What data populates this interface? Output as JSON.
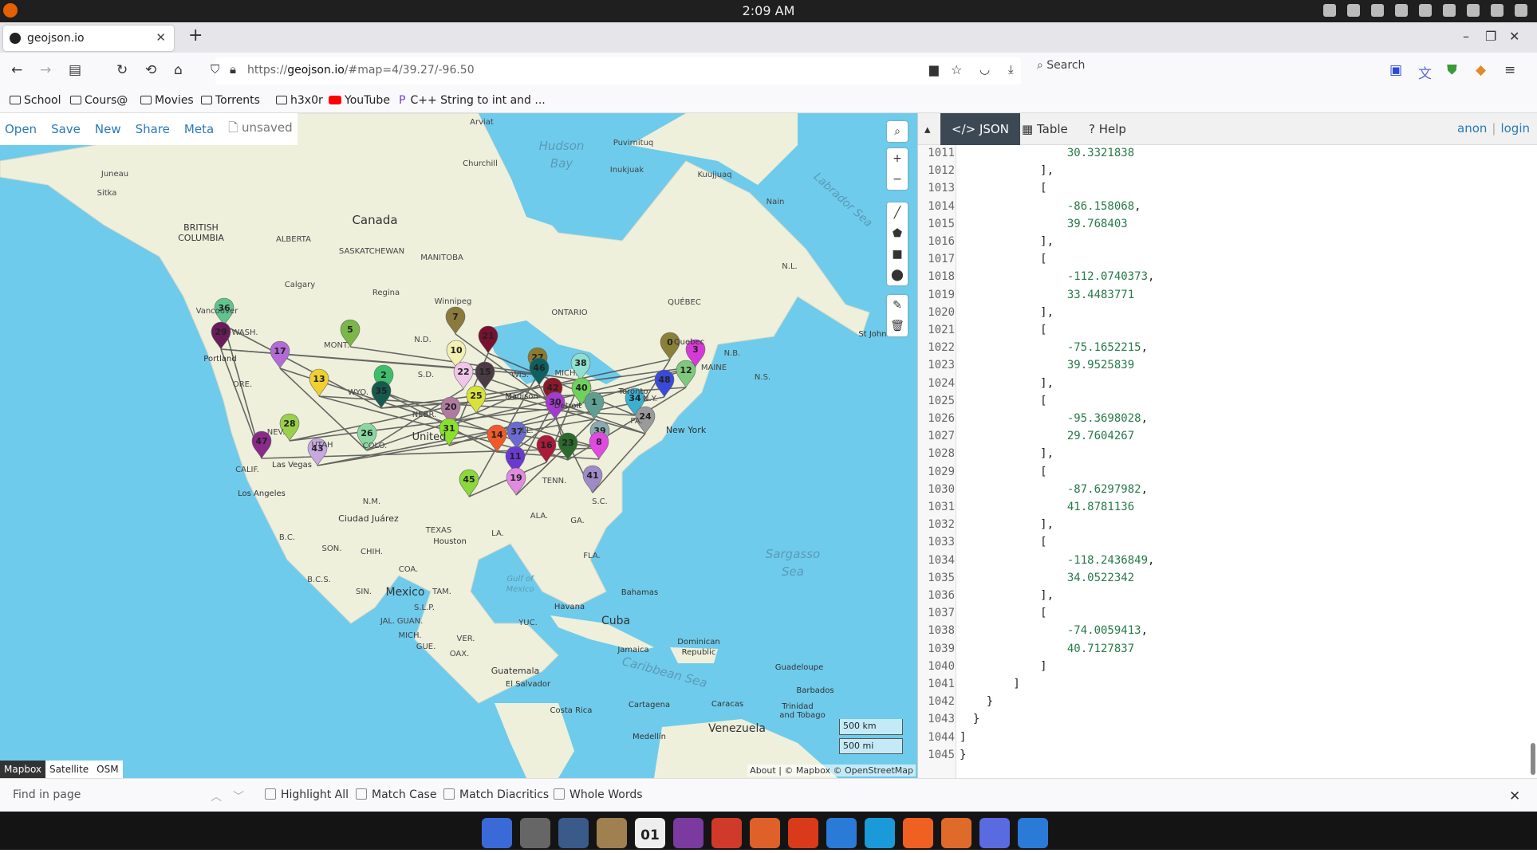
{
  "system": {
    "clock": "2:09 AM"
  },
  "tab": {
    "title": "geojson.io"
  },
  "address": {
    "prefix": "https://",
    "host": "geojson.io",
    "path": "/#map=4/39.27/-96.50",
    "search_placeholder": "Search"
  },
  "bookmarks": [
    "School",
    "Cours@",
    "Movies",
    "Torrents",
    "h3x0r",
    "YouTube",
    "C++ String to int and ..."
  ],
  "toolbar": {
    "open": "Open",
    "save": "Save",
    "new": "New",
    "share": "Share",
    "meta": "Meta",
    "status": "unsaved"
  },
  "panel_tabs": {
    "json": "JSON",
    "table": "Table",
    "help": "Help"
  },
  "auth": {
    "anon": "anon",
    "sep": "|",
    "login": "login"
  },
  "map_labels": {
    "hudson": "Hudson",
    "bay": "Bay",
    "canada": "Canada",
    "bc1": "BRITISH",
    "bc2": "COLUMBIA",
    "alberta": "ALBERTA",
    "sask": "SASKATCHEWAN",
    "manitoba": "MANITOBA",
    "ontario": "ONTARIO",
    "quebec_prov": "QUÉBEC",
    "nl": "N.L.",
    "nb": "N.B.",
    "ns": "N.S.",
    "labrador": "Labrador Sea",
    "arviat": "Arviat",
    "churchill": "Churchill",
    "puvirnituq": "Puvirnituq",
    "inukjuak": "Inukjuak",
    "kuujjuaq": "Kuujjuaq",
    "nain": "Nain",
    "juneau": "Juneau",
    "sitka": "Sitka",
    "calgary": "Calgary",
    "regina": "Regina",
    "winnipeg": "Winnipeg",
    "vancouver": "Vancouver",
    "wash": "WASH.",
    "mont": "MONT.",
    "nd": "N.D.",
    "sd": "S.D.",
    "wyo": "WYO.",
    "ore": "ORE.",
    "nev": "NEV.",
    "utah": "UTAH",
    "colo": "COLO.",
    "calif": "CALIF.",
    "nebr": "NEBR.",
    "ill": "ILL.",
    "mich": "MICH.",
    "wis": "WIS.",
    "ny": "N.Y.",
    "maine": "MAINE",
    "pa": "PA.",
    "tenn": "TENN.",
    "ga": "GA.",
    "sc": "S.C.",
    "fla": "FLA.",
    "texas": "TEXAS",
    "nm": "N.M.",
    "la": "LA.",
    "ala": "ALA.",
    "portland": "Portland",
    "lasvegas": "Las Vegas",
    "losangeles": "Los Angeles",
    "houston": "Houston",
    "newyork": "New York",
    "toronto": "Toronto",
    "quebec": "Quebec",
    "stjohn": "St John",
    "detroit": "Detroit",
    "madison": "Madison",
    "ciudad": "Ciudad Juárez",
    "son": "SON.",
    "chih": "CHIH.",
    "coa": "COA.",
    "bc": "B.C.",
    "bcs": "B.C.S.",
    "sin": "SIN.",
    "mexico": "Mexico",
    "tam": "TAM.",
    "slp": "S.L.P.",
    "jal": "JAL.",
    "guan": "GUAN.",
    "mich_mx": "MICH.",
    "gue": "GUE.",
    "oax": "OAX.",
    "ver": "VER.",
    "yuc": "YUC.",
    "gulf1": "Gulf of",
    "gulf2": "Mexico",
    "sargasso1": "Sargasso",
    "sargasso2": "Sea",
    "bahamas": "Bahamas",
    "havana": "Havana",
    "cuba": "Cuba",
    "jamaica": "Jamaica",
    "dominican1": "Dominican",
    "dominican2": "Republic",
    "guadeloupe": "Guadeloupe",
    "barbados": "Barbados",
    "caribbean": "Caribbean Sea",
    "guatemala": "Guatemala",
    "elsalvador": "El Salvador",
    "costarica": "Costa Rica",
    "cartagena": "Cartagena",
    "caracas": "Caracas",
    "trinidad1": "Trinidad",
    "trinidad2": "and Tobago",
    "venezuela": "Venezuela",
    "medellin": "Medellín",
    "united": "United"
  },
  "scale": {
    "km": "500 km",
    "mi": "500 mi"
  },
  "attribution": "About | © Mapbox © OpenStreetMap",
  "layers": [
    "Mapbox",
    "Satellite",
    "OSM"
  ],
  "markers": [
    {
      "n": "36",
      "c": "#5fc58f"
    },
    {
      "n": "29",
      "c": "#6a1b5a"
    },
    {
      "n": "17",
      "c": "#b36ad6"
    },
    {
      "n": "5",
      "c": "#7ab648"
    },
    {
      "n": "7",
      "c": "#8a7a3c"
    },
    {
      "n": "21",
      "c": "#7a1030"
    },
    {
      "n": "10",
      "c": "#f3f0b0"
    },
    {
      "n": "13",
      "c": "#f0d030"
    },
    {
      "n": "2",
      "c": "#3dbf6a"
    },
    {
      "n": "35",
      "c": "#155a4d"
    },
    {
      "n": "22",
      "c": "#f2c6ea"
    },
    {
      "n": "15",
      "c": "#4a3b44"
    },
    {
      "n": "27",
      "c": "#8c7a30"
    },
    {
      "n": "46",
      "c": "#0f5f60"
    },
    {
      "n": "38",
      "c": "#8fe0d0"
    },
    {
      "n": "0",
      "c": "#8a8038"
    },
    {
      "n": "3",
      "c": "#d63ad6"
    },
    {
      "n": "12",
      "c": "#7ec97e"
    },
    {
      "n": "48",
      "c": "#3a4ad8"
    },
    {
      "n": "25",
      "c": "#d8e23a"
    },
    {
      "n": "42",
      "c": "#8a1a2a"
    },
    {
      "n": "40",
      "c": "#6ed25a"
    },
    {
      "n": "34",
      "c": "#3ab0d0"
    },
    {
      "n": "1",
      "c": "#5f9e90"
    },
    {
      "n": "20",
      "c": "#b07aa0"
    },
    {
      "n": "30",
      "c": "#a43ad0"
    },
    {
      "n": "24",
      "c": "#9a9a9a"
    },
    {
      "n": "28",
      "c": "#9ad04a"
    },
    {
      "n": "47",
      "c": "#8a2a8a"
    },
    {
      "n": "43",
      "c": "#c8a8e0"
    },
    {
      "n": "26",
      "c": "#8ad8a0"
    },
    {
      "n": "31",
      "c": "#8ae02a"
    },
    {
      "n": "14",
      "c": "#f05a2a"
    },
    {
      "n": "37",
      "c": "#6a6ad0"
    },
    {
      "n": "16",
      "c": "#aa1a3a"
    },
    {
      "n": "23",
      "c": "#2a6a2a"
    },
    {
      "n": "39",
      "c": "#8aaab0"
    },
    {
      "n": "8",
      "c": "#e04ae0"
    },
    {
      "n": "11",
      "c": "#6a3ad0"
    },
    {
      "n": "19",
      "c": "#e08ae0"
    },
    {
      "n": "45",
      "c": "#8ad83a"
    },
    {
      "n": "41",
      "c": "#a08ac8"
    }
  ],
  "code_lines": [
    {
      "n": "1011",
      "t": "                30.3321838"
    },
    {
      "n": "1012",
      "t": "            ],"
    },
    {
      "n": "1013",
      "t": "            ["
    },
    {
      "n": "1014",
      "t": "                -86.158068,"
    },
    {
      "n": "1015",
      "t": "                39.768403"
    },
    {
      "n": "1016",
      "t": "            ],"
    },
    {
      "n": "1017",
      "t": "            ["
    },
    {
      "n": "1018",
      "t": "                -112.0740373,"
    },
    {
      "n": "1019",
      "t": "                33.4483771"
    },
    {
      "n": "1020",
      "t": "            ],"
    },
    {
      "n": "1021",
      "t": "            ["
    },
    {
      "n": "1022",
      "t": "                -75.1652215,"
    },
    {
      "n": "1023",
      "t": "                39.9525839"
    },
    {
      "n": "1024",
      "t": "            ],"
    },
    {
      "n": "1025",
      "t": "            ["
    },
    {
      "n": "1026",
      "t": "                -95.3698028,"
    },
    {
      "n": "1027",
      "t": "                29.7604267"
    },
    {
      "n": "1028",
      "t": "            ],"
    },
    {
      "n": "1029",
      "t": "            ["
    },
    {
      "n": "1030",
      "t": "                -87.6297982,"
    },
    {
      "n": "1031",
      "t": "                41.8781136"
    },
    {
      "n": "1032",
      "t": "            ],"
    },
    {
      "n": "1033",
      "t": "            ["
    },
    {
      "n": "1034",
      "t": "                -118.2436849,"
    },
    {
      "n": "1035",
      "t": "                34.0522342"
    },
    {
      "n": "1036",
      "t": "            ],"
    },
    {
      "n": "1037",
      "t": "            ["
    },
    {
      "n": "1038",
      "t": "                -74.0059413,"
    },
    {
      "n": "1039",
      "t": "                40.7127837"
    },
    {
      "n": "1040",
      "t": "            ]"
    },
    {
      "n": "1041",
      "t": "        ]"
    },
    {
      "n": "1042",
      "t": "    }"
    },
    {
      "n": "1043",
      "t": "  }"
    },
    {
      "n": "1044",
      "t": "]"
    },
    {
      "n": "1045",
      "t": "}"
    }
  ],
  "findbar": {
    "placeholder": "Find in page",
    "highlight": "Highlight All",
    "matchcase": "Match Case",
    "diacritics": "Match Diacritics",
    "whole": "Whole Words"
  },
  "taskbar_icons": [
    "home-icon",
    "settings-icon",
    "terminal-icon",
    "archive-icon",
    "calendar-icon",
    "podcast-icon",
    "gmail-icon",
    "firefox-icon",
    "office-icon",
    "vscode-icon",
    "skype-icon",
    "brave-icon",
    "sublime-icon",
    "discord-icon",
    "kde-icon"
  ],
  "taskbar_calendar_day": "01",
  "colors": {
    "water": "#6fcbeb",
    "land": "#eef0dc",
    "accent": "#2a7ab8",
    "json_tab": "#3c4955",
    "numeric": "#267a48"
  }
}
